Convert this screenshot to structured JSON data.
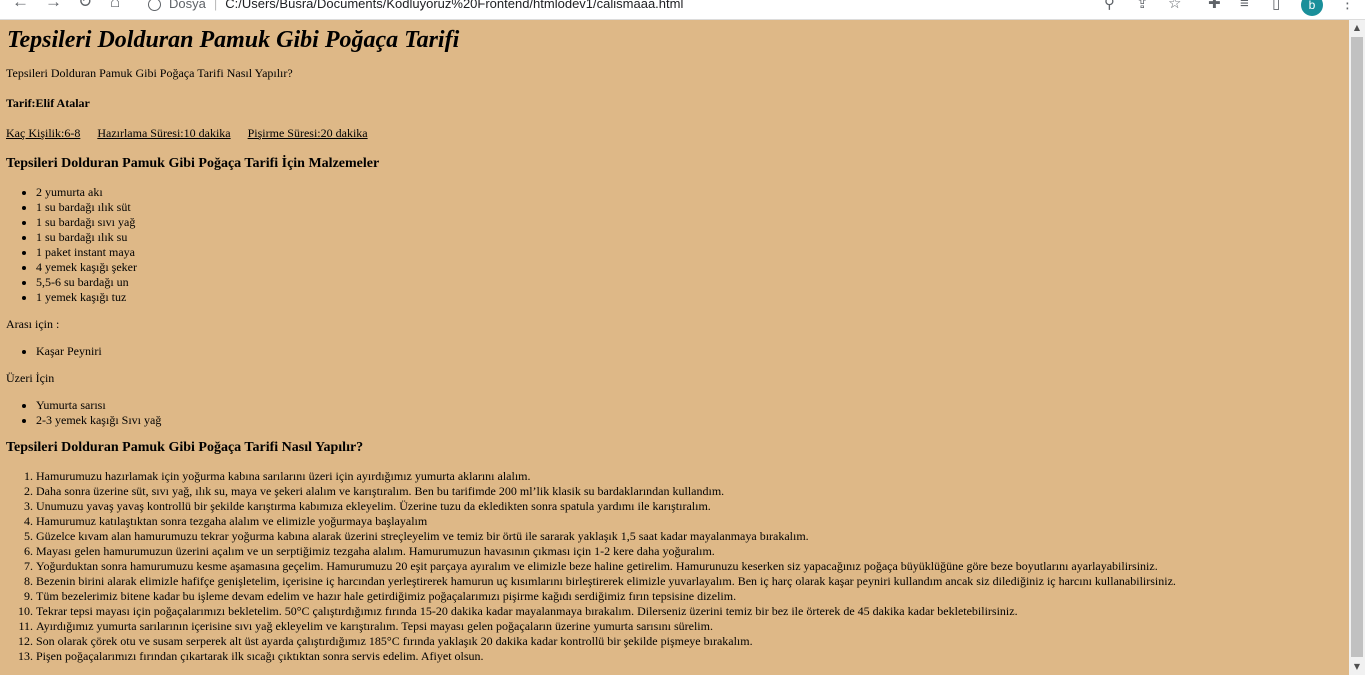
{
  "browser": {
    "security_label": "Dosya",
    "url": "C:/Users/Busra/Documents/Kodluyoruz%20Frontend/htmlodev1/calismaaa.html",
    "profile_initial": "b"
  },
  "recipe": {
    "title": "Tepsileri Dolduran Pamuk Gibi Poğaça Tarifi",
    "subtitle": "Tepsileri Dolduran Pamuk Gibi Poğaça Tarifi Nasıl Yapılır?",
    "author": "Tarif:Elif Atalar",
    "servings": "Kaç Kişilik:6-8",
    "prep_time": "Hazırlama Süresi:10 dakika",
    "cook_time": "Pişirme Süresi:20 dakika",
    "ingredients_heading": "Tepsileri Dolduran Pamuk Gibi Poğaça Tarifi İçin Malzemeler",
    "ingredients": [
      "2 yumurta akı",
      "1 su bardağı ılık süt",
      "1 su bardağı sıvı yağ",
      "1 su bardağı ılık su",
      "1 paket instant maya",
      "4 yemek kaşığı şeker",
      "5,5-6 su bardağı un",
      "1 yemek kaşığı tuz"
    ],
    "filling_label": "Arası için :",
    "filling": [
      "Kaşar Peyniri"
    ],
    "topping_label": "Üzeri İçin",
    "topping": [
      "Yumurta sarısı",
      "2-3 yemek kaşığı Sıvı yağ"
    ],
    "steps_heading": "Tepsileri Dolduran Pamuk Gibi Poğaça Tarifi Nasıl Yapılır?",
    "steps": [
      "Hamurumuzu hazırlamak için yoğurma kabına sarılarını üzeri için ayırdığımız yumurta aklarını alalım.",
      "Daha sonra üzerine süt, sıvı yağ, ılık su, maya ve şekeri alalım ve karıştıralım. Ben bu tarifimde 200 ml’lik klasik su bardaklarından kullandım.",
      "Unumuzu yavaş yavaş kontrollü bir şekilde karıştırma kabımıza ekleyelim. Üzerine tuzu da ekledikten sonra spatula yardımı ile karıştıralım.",
      "Hamurumuz katılaştıktan sonra tezgaha alalım ve elimizle yoğurmaya başlayalım",
      "Güzelce kıvam alan hamurumuzu tekrar yoğurma kabına alarak üzerini streçleyelim ve temiz bir örtü ile sararak yaklaşık 1,5 saat kadar mayalanmaya bırakalım.",
      "Mayası gelen hamurumuzun üzerini açalım ve un serptiğimiz tezgaha alalım. Hamurumuzun havasının çıkması için 1-2 kere daha yoğuralım.",
      "Yoğurduktan sonra hamurumuzu kesme aşamasına geçelim. Hamurumuzu 20 eşit parçaya ayıralım ve elimizle beze haline getirelim. Hamurunuzu keserken siz yapacağınız poğaça büyüklüğüne göre beze boyutlarını ayarlayabilirsiniz.",
      "Bezenin birini alarak elimizle hafifçe genişletelim, içerisine iç harcından yerleştirerek hamurun uç kısımlarını birleştirerek elimizle yuvarlayalım. Ben iç harç olarak kaşar peyniri kullandım ancak siz dilediğiniz iç harcını kullanabilirsiniz.",
      "Tüm bezelerimiz bitene kadar bu işleme devam edelim ve hazır hale getirdiğimiz poğaçalarımızı pişirme kağıdı serdiğimiz fırın tepsisine dizelim.",
      "Tekrar tepsi mayası için poğaçalarımızı bekletelim. 50°C çalıştırdığımız fırında 15-20 dakika kadar mayalanmaya bırakalım. Dilerseniz üzerini temiz bir bez ile örterek de 45 dakika kadar bekletebilirsiniz.",
      "Ayırdığımız yumurta sarılarının içerisine sıvı yağ ekleyelim ve karıştıralım. Tepsi mayası gelen poğaçaların üzerine yumurta sarısını sürelim.",
      "Son olarak çörek otu ve susam serperek alt üst ayarda çalıştırdığımız 185°C fırında yaklaşık 20 dakika kadar kontrollü bir şekilde pişmeye bırakalım.",
      "Pişen poğaçalarımızı fırından çıkartarak ilk sıcağı çıktıktan sonra servis edelim. Afiyet olsun."
    ]
  }
}
